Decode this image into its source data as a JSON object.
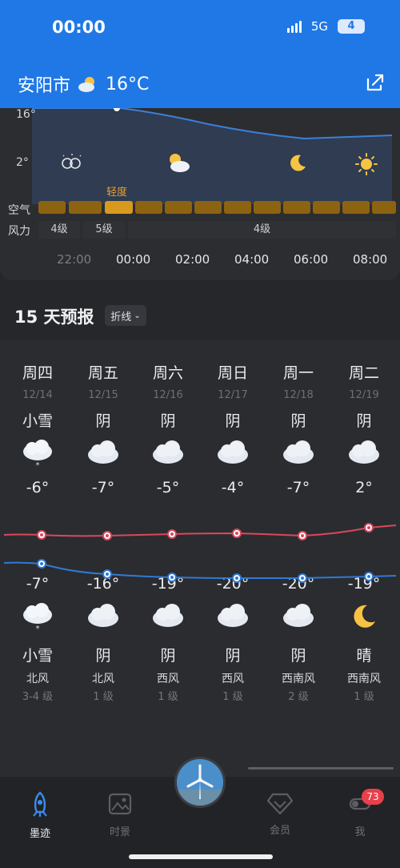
{
  "status": {
    "time": "00:00",
    "network": "5G",
    "battery": "4"
  },
  "header": {
    "city": "安阳市",
    "temperature": "16°C",
    "weather_icon": "cloudy-sun-icon",
    "share_icon": "share-icon"
  },
  "hourly": {
    "y_labels": [
      "16°",
      "2°"
    ],
    "air_label": "空气",
    "wind_label": "风力",
    "air_level": "轻度",
    "wind_levels": [
      "4级",
      "5级",
      "4级"
    ],
    "hours": [
      "22:00",
      "00:00",
      "02:00",
      "04:00",
      "06:00",
      "08:00"
    ],
    "icons": [
      "clear-night-icon",
      "cloudy-sun-icon",
      "moon-icon",
      "sun-icon"
    ]
  },
  "forecast": {
    "title": "15 天预报",
    "mode": "折线",
    "days": [
      {
        "dow": "周四",
        "date": "12/14",
        "day_weather": "小雪",
        "high": "-6°",
        "low": "-7°",
        "night_weather": "小雪",
        "wind": "北风",
        "wind_level": "3-4 级"
      },
      {
        "dow": "周五",
        "date": "12/15",
        "day_weather": "阴",
        "high": "-7°",
        "low": "-16°",
        "night_weather": "阴",
        "wind": "北风",
        "wind_level": "1 级"
      },
      {
        "dow": "周六",
        "date": "12/16",
        "day_weather": "阴",
        "high": "-5°",
        "low": "-19°",
        "night_weather": "阴",
        "wind": "西风",
        "wind_level": "1 级"
      },
      {
        "dow": "周日",
        "date": "12/17",
        "day_weather": "阴",
        "high": "-4°",
        "low": "-20°",
        "night_weather": "阴",
        "wind": "西风",
        "wind_level": "1 级"
      },
      {
        "dow": "周一",
        "date": "12/18",
        "day_weather": "阴",
        "high": "-7°",
        "low": "-20°",
        "night_weather": "阴",
        "wind": "西南风",
        "wind_level": "2 级"
      },
      {
        "dow": "周二",
        "date": "12/19",
        "day_weather": "阴",
        "high": "2°",
        "low": "-19°",
        "night_weather": "晴",
        "wind": "西南风",
        "wind_level": "1 级"
      }
    ]
  },
  "nav": {
    "items": [
      "墨迹",
      "时景",
      "会员",
      "我"
    ],
    "badge": "73",
    "accent": "#3b8cf0"
  }
}
